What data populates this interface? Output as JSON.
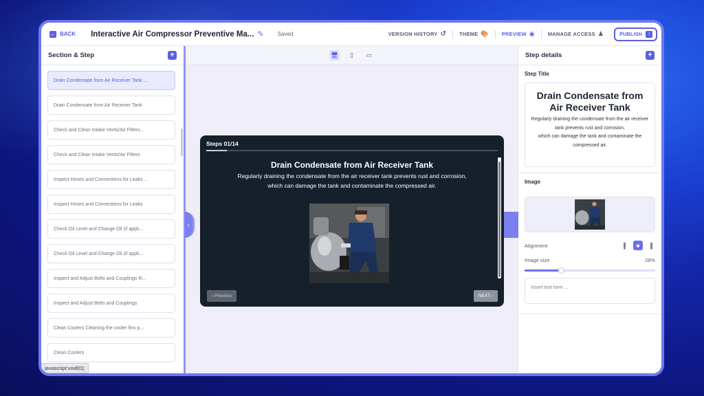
{
  "topbar": {
    "back_label": "BACK",
    "doc_title": "Interactive Air Compressor Preventive Ma...",
    "save_status": "Saved",
    "version_history_label": "VERSION HISTORY",
    "theme_label": "THEME",
    "preview_label": "PREVIEW",
    "manage_access_label": "MANAGE ACCESS",
    "publish_label": "PUBLISH"
  },
  "left_panel": {
    "title": "Section & Step",
    "items": [
      {
        "label": "Drain Condensate from Air Receiver Tank ...",
        "active": true
      },
      {
        "label": "Drain Condensate from Air Receiver Tank"
      },
      {
        "label": "Check and Clean Intake Vents/Air Filters..."
      },
      {
        "label": "Check and Clean Intake Vents/Air Filters"
      },
      {
        "label": "Inspect Hoses and Connections for Leaks ..."
      },
      {
        "label": "Inspect Hoses and Connections for Leaks"
      },
      {
        "label": "Check Oil Level and Change Oil (if appli..."
      },
      {
        "label": "Check Oil Level and Change Oil (if appli..."
      },
      {
        "label": "Inspect and Adjust Belts and Couplings R..."
      },
      {
        "label": "Inspect and Adjust Belts and Couplings"
      },
      {
        "label": "Clean Coolers Cleaning the cooler fins p..."
      },
      {
        "label": "Clean Coolers"
      }
    ],
    "status_url": "javascript:void(0);"
  },
  "preview": {
    "steps_label": "Steps 01/14",
    "progress": 0.07,
    "title": "Drain Condensate from Air Receiver Tank",
    "desc_line1": "Regularly draining the condensate from the air receiver tank prevents rust and corrosion,",
    "desc_line2": "which can damage the tank and contaminate the compressed air.",
    "prev_label": "Previous",
    "next_label": "NEXT"
  },
  "right_panel": {
    "title": "Step details",
    "step_title_label": "Step Title",
    "step_title_text": "Drain Condensate from Air Receiver Tank",
    "step_desc_line1": "Regularly draining the condensate from the air receiver",
    "step_desc_line2": "tank prevents rust and corrosion,",
    "step_desc_line3": "which can damage the tank and contaminate the",
    "step_desc_line4": "compressed air.",
    "image_label": "Image",
    "alignment_label": "Alignment",
    "image_size_label": "Image size",
    "image_size_value": "28%",
    "image_size_fraction": 0.28,
    "text_placeholder": "Insert text here ..."
  },
  "colors": {
    "accent": "#5b5fe0",
    "card_bg": "#16202c"
  }
}
